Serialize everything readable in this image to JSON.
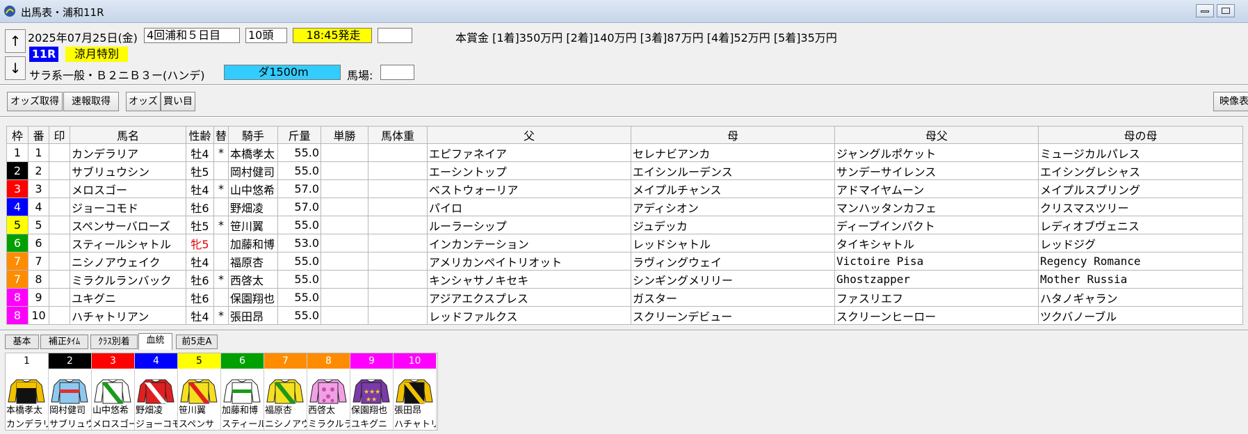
{
  "window": {
    "title": "出馬表・浦和11R"
  },
  "header": {
    "date": "2025年07月25日(金)",
    "meeting": "4回浦和５日目",
    "runners": "10頭",
    "post_time": "18:45発走",
    "race_no": "11R",
    "race_name": "涼月特別",
    "condition": "サラ系一般・Ｂ２ニＢ３ー(ハンデ)",
    "course": "ダ1500m",
    "going_label": "馬場:",
    "prize": "本賞金 [1着]350万円 [2着]140万円 [3着]87万円 [4着]52万円 [5着]35万円",
    "up_arrow": "↑",
    "down_arrow": "↓"
  },
  "toolbar": {
    "odds_fetch": "オッズ取得",
    "flash_fetch": "速報取得",
    "odds": "オッズ",
    "bets": "買い目",
    "video": "映像表"
  },
  "columns": [
    "枠",
    "番",
    "印",
    "馬名",
    "性齢",
    "替",
    "騎手",
    "斤量",
    "単勝",
    "馬体重",
    "父",
    "母",
    "母父",
    "母の母"
  ],
  "frame_colors": {
    "1": "#ffffff",
    "2": "#000000",
    "3": "#ff0000",
    "4": "#0000ff",
    "5": "#ffff00",
    "6": "#00a000",
    "7": "#ff8c00",
    "8": "#ff00ff"
  },
  "frame_text_colors": {
    "1": "#000000",
    "2": "#ffffff",
    "3": "#ffffff",
    "4": "#ffffff",
    "5": "#000000",
    "6": "#ffffff",
    "7": "#ffffff",
    "8": "#ffffff"
  },
  "entries": [
    {
      "frame": "1",
      "no": "1",
      "horse": "カンデラリア",
      "sexage": "牡4",
      "swap": "*",
      "jockey": "本橋孝太",
      "weight": "55.0",
      "sire": "エピファネイア",
      "dam": "セレナビアンカ",
      "damsire": "ジャングルポケット",
      "damdam": "ミュージカルパレス"
    },
    {
      "frame": "2",
      "no": "2",
      "horse": "サブリュウシン",
      "sexage": "牡5",
      "swap": "",
      "jockey": "岡村健司",
      "weight": "55.0",
      "sire": "エーシントップ",
      "dam": "エイシンルーデンス",
      "damsire": "サンデーサイレンス",
      "damdam": "エイシングレシャス"
    },
    {
      "frame": "3",
      "no": "3",
      "horse": "メロスゴー",
      "sexage": "牡4",
      "swap": "*",
      "jockey": "山中悠希",
      "weight": "57.0",
      "sire": "ベストウォーリア",
      "dam": "メイプルチャンス",
      "damsire": "アドマイヤムーン",
      "damdam": "メイプルスプリング"
    },
    {
      "frame": "4",
      "no": "4",
      "horse": "ジョーコモド",
      "sexage": "牡6",
      "swap": "",
      "jockey": "野畑凌",
      "weight": "57.0",
      "sire": "パイロ",
      "dam": "アディシオン",
      "damsire": "マンハッタンカフェ",
      "damdam": "クリスマスツリー"
    },
    {
      "frame": "5",
      "no": "5",
      "horse": "スペンサーバローズ",
      "sexage": "牡5",
      "swap": "*",
      "jockey": "笹川翼",
      "weight": "55.0",
      "sire": "ルーラーシップ",
      "dam": "ジュデッカ",
      "damsire": "ディープインパクト",
      "damdam": "レディオブヴェニス"
    },
    {
      "frame": "6",
      "no": "6",
      "horse": "スティールシャトル",
      "sexage": "牝5",
      "swap": "",
      "jockey": "加藤和博",
      "weight": "53.0",
      "sire": "インカンテーション",
      "dam": "レッドシャトル",
      "damsire": "タイキシャトル",
      "damdam": "レッドジグ"
    },
    {
      "frame": "7",
      "no": "7",
      "horse": "ニシノアウェイク",
      "sexage": "牡4",
      "swap": "",
      "jockey": "福原杏",
      "weight": "55.0",
      "sire": "アメリカンペイトリオット",
      "dam": "ラヴィングウェイ",
      "damsire": "Victoire Pisa",
      "damdam": "Regency Romance"
    },
    {
      "frame": "7",
      "no": "8",
      "horse": "ミラクルランバック",
      "sexage": "牡6",
      "swap": "*",
      "jockey": "西啓太",
      "weight": "55.0",
      "sire": "キンシャサノキセキ",
      "dam": "シンギングメリリー",
      "damsire": "Ghostzapper",
      "damdam": "Mother Russia"
    },
    {
      "frame": "8",
      "no": "9",
      "horse": "ユキグニ",
      "sexage": "牡6",
      "swap": "",
      "jockey": "保園翔也",
      "weight": "55.0",
      "sire": "アジアエクスプレス",
      "dam": "ガスター",
      "damsire": "ファスリエフ",
      "damdam": "ハタノギャラン"
    },
    {
      "frame": "8",
      "no": "10",
      "horse": "ハチャトリアン",
      "sexage": "牡4",
      "swap": "*",
      "jockey": "張田昂",
      "weight": "55.0",
      "sire": "レッドファルクス",
      "dam": "スクリーンデビュー",
      "damsire": "スクリーンヒーロー",
      "damdam": "ツクバノーブル"
    }
  ],
  "tabs": [
    "基本",
    "補正ﾀｲﾑ",
    "ｸﾗｽ別着",
    "血統",
    "前5走A"
  ],
  "active_tab": "血統",
  "silks": [
    {
      "no": "1",
      "color": "#ffffff",
      "text": "#000000",
      "jockey": "本橋孝太",
      "horse": "カンデラリ",
      "body": "#111111",
      "accent": "#f2c200",
      "sleeve": "#f2c200",
      "pattern": "yoke"
    },
    {
      "no": "2",
      "color": "#000000",
      "text": "#ffffff",
      "jockey": "岡村健司",
      "horse": "サブリュウ",
      "body": "#8ec9f0",
      "accent": "#e03030",
      "sleeve": "#8ec9f0",
      "pattern": "band"
    },
    {
      "no": "3",
      "color": "#ff0000",
      "text": "#ffffff",
      "jockey": "山中悠希",
      "horse": "メロスゴー",
      "body": "#ffffff",
      "accent": "#1a9a1a",
      "sleeve": "#ffffff",
      "pattern": "sash"
    },
    {
      "no": "4",
      "color": "#0000ff",
      "text": "#ffffff",
      "jockey": "野畑凌",
      "horse": "ジョーコモ",
      "body": "#e02020",
      "accent": "#ffffff",
      "sleeve": "#e02020",
      "pattern": "sash"
    },
    {
      "no": "5",
      "color": "#ffff00",
      "text": "#000000",
      "jockey": "笹川翼",
      "horse": "スペンサ",
      "body": "#f5e020",
      "accent": "#e02020",
      "sleeve": "#f5e020",
      "pattern": "sash"
    },
    {
      "no": "6",
      "color": "#00a000",
      "text": "#ffffff",
      "jockey": "加藤和博",
      "horse": "スティール",
      "body": "#ffffff",
      "accent": "#1a9a1a",
      "sleeve": "#ffffff",
      "pattern": "band"
    },
    {
      "no": "7",
      "color": "#ff8c00",
      "text": "#ffffff",
      "jockey": "福原杏",
      "horse": "ニシノアウ",
      "body": "#f5e020",
      "accent": "#1a9a1a",
      "sleeve": "#f5e020",
      "pattern": "sash"
    },
    {
      "no": "8",
      "color": "#ff8c00",
      "text": "#ffffff",
      "jockey": "西啓太",
      "horse": "ミラクルラ",
      "body": "#f2a0e6",
      "accent": "#c050b0",
      "sleeve": "#f2a0e6",
      "pattern": "dots"
    },
    {
      "no": "9",
      "color": "#ff00ff",
      "text": "#ffffff",
      "jockey": "保園翔也",
      "horse": "ユキグニ",
      "body": "#7a3aa8",
      "accent": "#f5d020",
      "sleeve": "#7a3aa8",
      "pattern": "stars"
    },
    {
      "no": "10",
      "color": "#ff00ff",
      "text": "#ffffff",
      "jockey": "張田昂",
      "horse": "ハチャトリ",
      "body": "#111111",
      "accent": "#f2c200",
      "sleeve": "#f2c200",
      "pattern": "sash"
    }
  ]
}
